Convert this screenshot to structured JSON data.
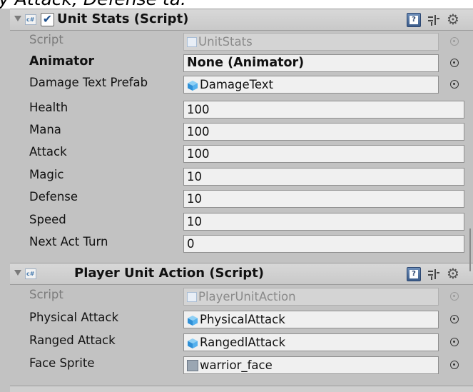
{
  "top_caption": "y Attack, Defense ta.",
  "unit_stats": {
    "title": "Unit Stats (Script)",
    "enabled_check": "✔",
    "icon_text": "c#",
    "rows": [
      {
        "label": "Script",
        "value": "UnitStats"
      },
      {
        "label": "Animator",
        "value": "None (Animator)"
      },
      {
        "label": "Damage Text Prefab",
        "value": "DamageText"
      },
      {
        "label": "Health",
        "value": "100"
      },
      {
        "label": "Mana",
        "value": "100"
      },
      {
        "label": "Attack",
        "value": "100"
      },
      {
        "label": "Magic",
        "value": "10"
      },
      {
        "label": "Defense",
        "value": "10"
      },
      {
        "label": "Speed",
        "value": "10"
      },
      {
        "label": "Next Act Turn",
        "value": "0"
      }
    ]
  },
  "player_unit_action": {
    "title": "Player Unit Action (Script)",
    "icon_text": "c#",
    "rows": [
      {
        "label": "Script",
        "value": "PlayerUnitAction"
      },
      {
        "label": "Physical Attack",
        "value": "PhysicalAttack"
      },
      {
        "label": "Ranged Attack",
        "value": "RangedlAttack"
      },
      {
        "label": "Face Sprite",
        "value": "warrior_face"
      }
    ]
  },
  "icons": {
    "help": "?",
    "gear": "⚙",
    "presets": "presets-icon"
  },
  "colors": {
    "background": "#c2c2c2",
    "field": "#f0f0f0",
    "disabled_text": "#7c7c7c",
    "accent": "#1d4f8c"
  }
}
